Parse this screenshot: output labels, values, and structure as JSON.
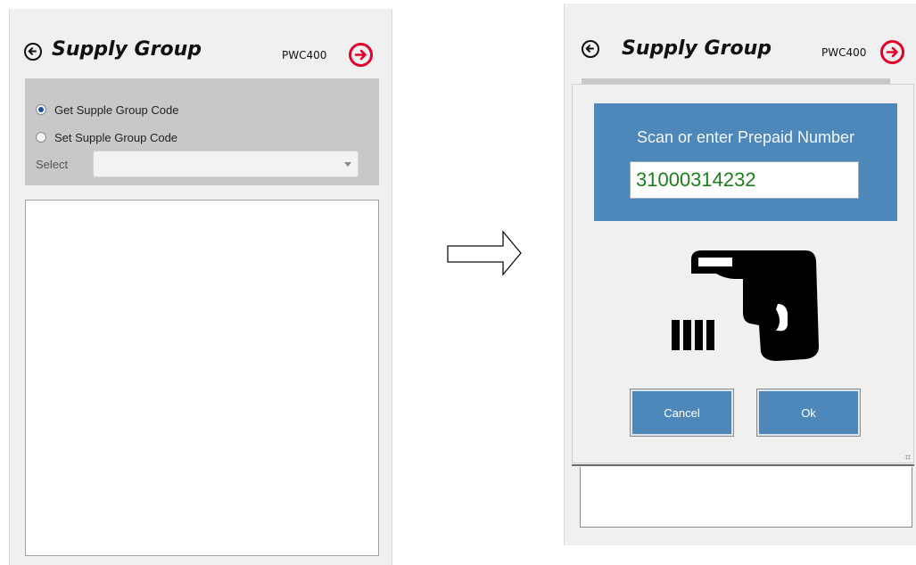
{
  "left": {
    "title": "Supply Group",
    "device": "PWC400",
    "options": [
      {
        "label": "Get Supple Group Code",
        "checked": true
      },
      {
        "label": "Set  Supple Group Code",
        "checked": false
      }
    ],
    "select_label": "Select",
    "select_value": ""
  },
  "right": {
    "title": "Supply Group",
    "device": "PWC400",
    "dialog": {
      "prompt": "Scan or enter Prepaid Number",
      "input_value": "31000314232",
      "cancel_label": "Cancel",
      "ok_label": "Ok"
    }
  },
  "colors": {
    "accent_blue": "#4e87ba",
    "next_red": "#e2002a",
    "input_green": "#1b7f1b",
    "panel_gray": "#c8c8c8"
  },
  "icons": [
    "back-arrow-icon",
    "forward-arrow-icon",
    "barcode-scanner-icon",
    "right-arrow-icon"
  ]
}
